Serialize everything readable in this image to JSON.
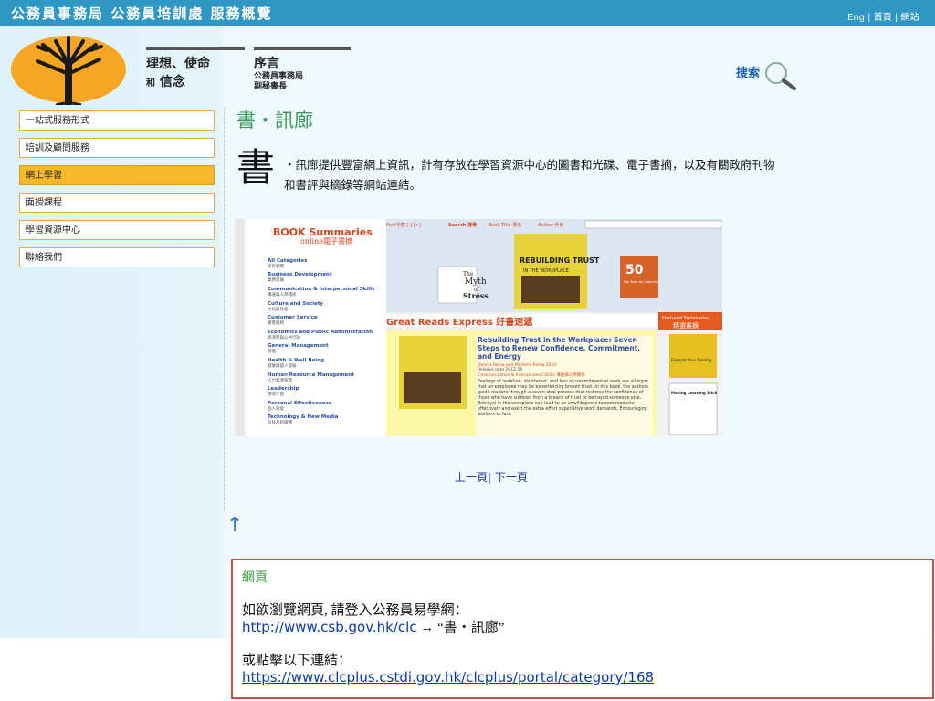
{
  "header": {
    "title": "公務員事務局 公務員培訓處 服務概覽",
    "links": "Eng | 首頁 | 網站"
  },
  "nav": {
    "mission_line1": "理想、使命",
    "mission_small": "和",
    "mission_line2": "信念",
    "preface_title": "序言",
    "preface_org": "公務員事務局",
    "preface_role": "副秘書長"
  },
  "search": {
    "label": "搜索",
    "icon": "magnifier-icon"
  },
  "sidebar": {
    "items": [
      {
        "label": "一站式服務形式",
        "active": false
      },
      {
        "label": "培訓及顧問服務",
        "active": false
      },
      {
        "label": "網上學習",
        "active": true
      },
      {
        "label": "面授課程",
        "active": false
      },
      {
        "label": "學習資源中心",
        "active": false
      },
      {
        "label": "聯絡我們",
        "active": false
      }
    ]
  },
  "main": {
    "heading": "書‧訊廊",
    "big_char": "書",
    "intro": "‧訊廊提供豐富網上資訊，計有存放在學習資源中心的圖書和光碟、電子書摘，以及有關政府刊物和書評與摘錄等網站連結。",
    "pager": "上一頁| 下一頁",
    "up_arrow": "↑"
  },
  "screenshot": {
    "brand_top": "BOOK Summaries",
    "brand_bottom": "online電子書摘",
    "font_label": "Font字體 [-] [+]",
    "search_label": "Search 搜尋",
    "book_title_opt": "Book Title 書名",
    "author_opt": "Author 作者",
    "categories": [
      {
        "en": "All Categories",
        "zh": "所有範疇"
      },
      {
        "en": "Business Development",
        "zh": "業務發展"
      },
      {
        "en": "Communication & Interpersonal Skills",
        "zh": "溝通與人際關係"
      },
      {
        "en": "Culture and Society",
        "zh": "文化與社會"
      },
      {
        "en": "Customer Service",
        "zh": "顧客服務"
      },
      {
        "en": "Economics and Public Administration",
        "zh": "經濟學與公共行政"
      },
      {
        "en": "General Management",
        "zh": "管理"
      },
      {
        "en": "Health & Well Being",
        "zh": "健康與個人發展"
      },
      {
        "en": "Human Resource Management",
        "zh": "人力資源管理"
      },
      {
        "en": "Leadership",
        "zh": "領導才能"
      },
      {
        "en": "Personal Effectiveness",
        "zh": "個人效能"
      },
      {
        "en": "Technology & New Media",
        "zh": "科技及新媒體"
      }
    ],
    "book1_title": "REBUILDING TRUST",
    "book1_sub": "IN THE WORKPLACE",
    "book2_line1": "The",
    "book2_line2": "Myth",
    "book2_line3": "of",
    "book2_line4": "Stress",
    "book3_num": "50",
    "book3_sub": "Top Tools for Coaching",
    "great_reads": "Great Reads Express 好書速遞",
    "featured": "Featured Summaries",
    "featured_zh": "精選書摘",
    "article_title": "Rebuilding Trust in the Workplace: Seven Steps to Renew Confidence, Commitment, and Energy",
    "article_authors": "Dennis Reina and Michelle Reina 2010",
    "article_release": "Release date 2012-10",
    "article_category": "Communication & Interpersonal Skills 溝通與人際關係",
    "article_body": "Feelings of isolation, disinterest, and loss of commitment at work are all signs that an employee may be experiencing broken trust. In this book, the authors guide readers through a seven-step process that restores the confidence of those who have suffered from a breach of trust or betrayed someone else. Betrayal in the workplace can lead to an unwillingness to communicate effectively and exert the extra effort superlative work demands. Encouraging workers to face",
    "side_book1": "Energize Your Training",
    "side_book2": "Making Learning Stick"
  },
  "infobox": {
    "heading": "網頁",
    "line1": "如欲瀏覽網頁, 請登入公務員易學網：",
    "link1": "http://www.csb.gov.hk/clc",
    "arrow": " → “書‧訊廊”",
    "line2": "或點擊以下連結：",
    "link2": "https://www.clcplus.cstdi.gov.hk/clcplus/portal/category/168"
  },
  "colors": {
    "header_bg": "#2f97c4",
    "sidebar_active": "#f7b928",
    "sidebar_border": "#e8a94d",
    "heading_green": "#3a9a5a",
    "box_border": "#d24b4b",
    "link": "#0b3aa6"
  }
}
